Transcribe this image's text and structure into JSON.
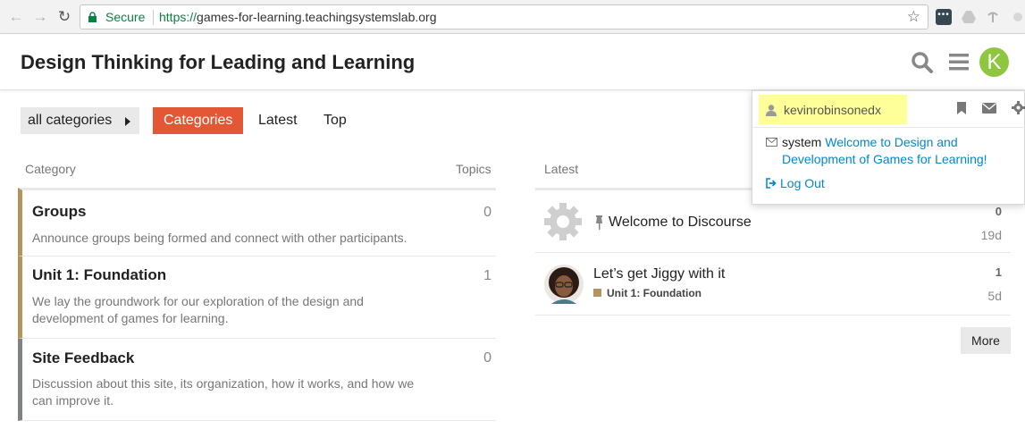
{
  "browser": {
    "secure_label": "Secure",
    "url_scheme": "https://",
    "url_domain": "games-for-learning.teachingsystemslab.org",
    "nav_back": "←",
    "nav_forward": "→",
    "nav_reload": "↻",
    "star": "☆"
  },
  "header": {
    "title": "Design Thinking for Leading and Learning",
    "avatar_letter": "K",
    "avatar_color": "#8ec63f"
  },
  "nav": {
    "category_dropdown": "all categories",
    "pills": [
      "Categories",
      "Latest",
      "Top"
    ],
    "active_color": "#e45735"
  },
  "categories": {
    "header_category": "Category",
    "header_topics": "Topics",
    "rows": [
      {
        "name": "Groups",
        "description": "Announce groups being formed and connect with other participants.",
        "topics": "0",
        "color": "#b3945e"
      },
      {
        "name": "Unit 1: Foundation",
        "description": "We lay the groundwork for our exploration of the design and development of games for learning.",
        "topics": "1",
        "color": "#b3945e"
      },
      {
        "name": "Site Feedback",
        "description": "Discussion about this site, its organization, how it works, and how we can improve it.",
        "topics": "0",
        "color": "#808281"
      }
    ]
  },
  "latest": {
    "header": "Latest",
    "topics": [
      {
        "title": "Welcome to Discourse",
        "posts": "0",
        "age": "19d",
        "pinned": true
      },
      {
        "title": "Let’s get Jiggy with it",
        "category": "Unit 1: Foundation",
        "posts": "1",
        "age": "5d"
      }
    ],
    "more_label": "More"
  },
  "user_menu": {
    "username": "kevinrobinsonedx",
    "notification_user": "system",
    "notification_text": "Welcome to Design and Development of Games for Learning!",
    "logout_label": "Log Out",
    "highlight_color": "#ffff99"
  }
}
